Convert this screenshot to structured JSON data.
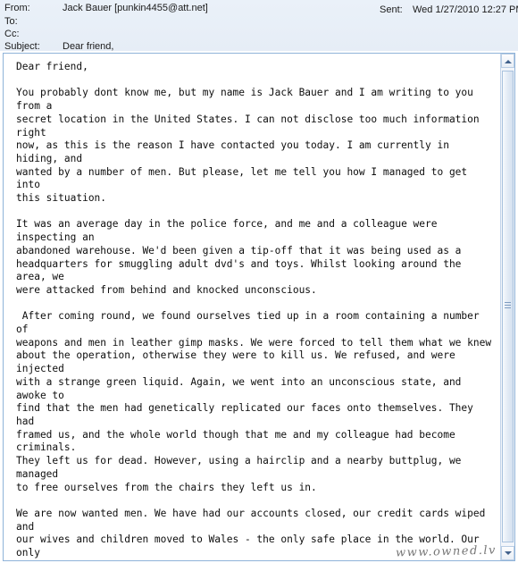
{
  "header": {
    "from_label": "From:",
    "from_value": "Jack Bauer [punkin4455@att.net]",
    "to_label": "To:",
    "to_value": "",
    "cc_label": "Cc:",
    "cc_value": "",
    "subject_label": "Subject:",
    "subject_value": "Dear friend,",
    "sent_label": "Sent:",
    "sent_value": "Wed 1/27/2010 12:27 PM"
  },
  "body": {
    "text": "Dear friend,\n\nYou probably dont know me, but my name is Jack Bauer and I am writing to you from a\nsecret location in the United States. I can not disclose too much information right\nnow, as this is the reason I have contacted you today. I am currently in hiding, and\nwanted by a number of men. But please, let me tell you how I managed to get into\nthis situation.\n\nIt was an average day in the police force, and me and a colleague were inspecting an\nabandoned warehouse. We'd been given a tip-off that it was being used as a\nheadquarters for smuggling adult dvd's and toys. Whilst looking around the area, we\nwere attacked from behind and knocked unconscious.\n\n After coming round, we found ourselves tied up in a room containing a number of\nweapons and men in leather gimp masks. We were forced to tell them what we knew\nabout the operation, otherwise they were to kill us. We refused, and were injected\nwith a strange green liquid. Again, we went into an unconscious state, and awoke to\nfind that the men had genetically replicated our faces onto themselves. They had\nframed us, and the whole world though that me and my colleague had become criminals.\nThey left us for dead. However, using a hairclip and a nearby buttplug, we managed\nto free ourselves from the chairs they left us in.\n\nWe are now wanted men. We have had our accounts closed, our credit cards wiped and\nour wives and children moved to Wales - the only safe place in the world. Our only\nchance of freedom is a good friend, a scientist named John Locke who is based in\nWest Africa. He has agreed to use his blood analysis machine, the BAM500, to prove\nthat we are innocent. However, we are stranded in the US and need $4000 to get\nthere. If proven innocent, we are guaranteed $12,500,000USD as a settlement fee,\nwhich we will give you 30% of if you help us. I will need the following:\n\nName:\nAddress:\nMarital status:\nBlood type:\n\nPlease, if you are willing to help then email back as soon as possible, or contact\nJohn Locke. If you need his email I can provide you with it.\nPlease hurry as there is not much time,\n\nGod bless\nJack Bauer"
  },
  "watermark": {
    "text": "www.owned.lv"
  },
  "colors": {
    "header_background": "#e9f0f8",
    "pane_border": "#8fb3d9",
    "body_background": "#ffffff",
    "text": "#0d0d0d",
    "scrollbar_track": "#f2f5fa",
    "scrollbar_thumb": "#dce7f3"
  }
}
